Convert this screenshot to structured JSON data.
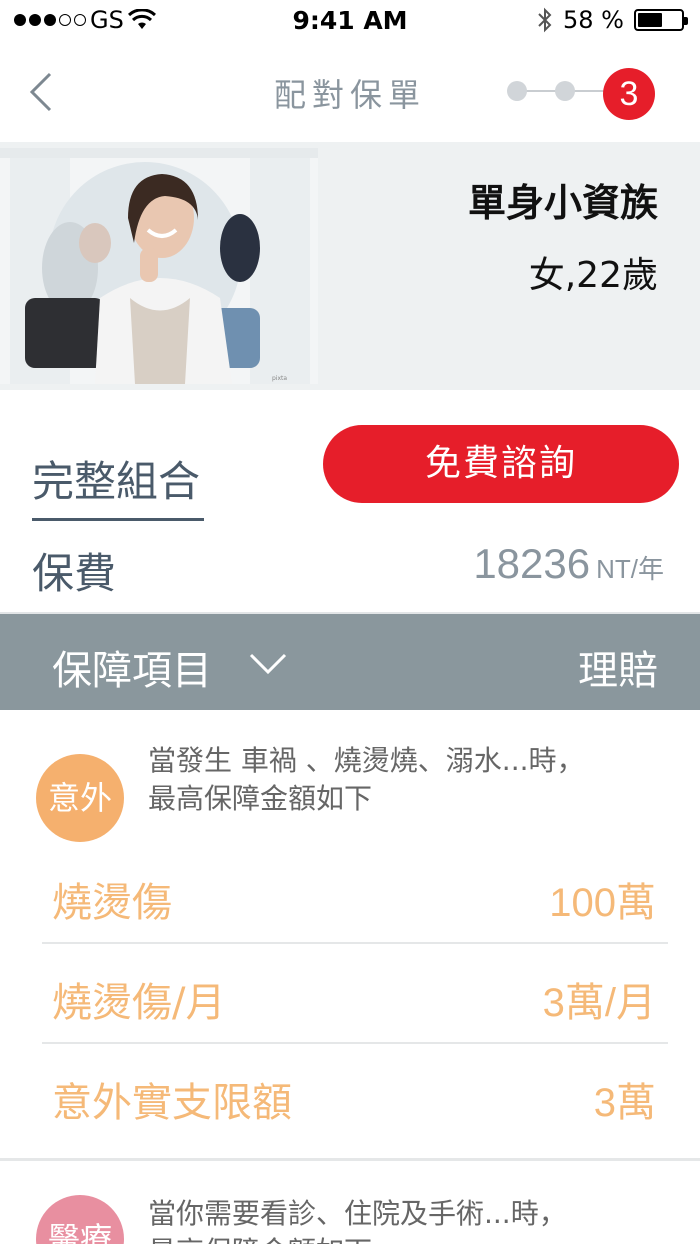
{
  "status": {
    "carrier": "GS",
    "time": "9:41 AM",
    "battery": "58 %",
    "battery_level": 0.58
  },
  "nav": {
    "title": "配對保單",
    "current_step": "3",
    "back_icon": "chevron-left-icon"
  },
  "profile": {
    "name": "單身小資族",
    "meta": "女,22歲"
  },
  "plan": {
    "tab_label": "完整組合",
    "consult_button": "免費諮詢",
    "premium_label": "保費",
    "premium_value": "18236",
    "premium_unit": "NT/年"
  },
  "coverage": {
    "header_title": "保障項目",
    "header_claim": "理賠"
  },
  "sections": [
    {
      "badge": "意外",
      "badge_color": "#f5b06e",
      "desc_line1": "當發生 車禍 、燒燙燒、溺水...時，",
      "desc_line2": "最高保障金額如下",
      "items": [
        {
          "name": "燒燙傷",
          "value": "100萬"
        },
        {
          "name": "燒燙傷/月",
          "value": "3萬/月"
        },
        {
          "name": "意外實支限額",
          "value": "3萬"
        }
      ]
    },
    {
      "badge": "醫療",
      "badge_color": "#e88fa0",
      "desc_line1": "當你需要看診、住院及手術...時，",
      "desc_line2": "最高保障金額如下"
    }
  ],
  "colors": {
    "accent_red": "#e61e2a",
    "slate": "#4a5a6a",
    "header_gray": "#8a979d",
    "item_orange": "#f5b978"
  }
}
